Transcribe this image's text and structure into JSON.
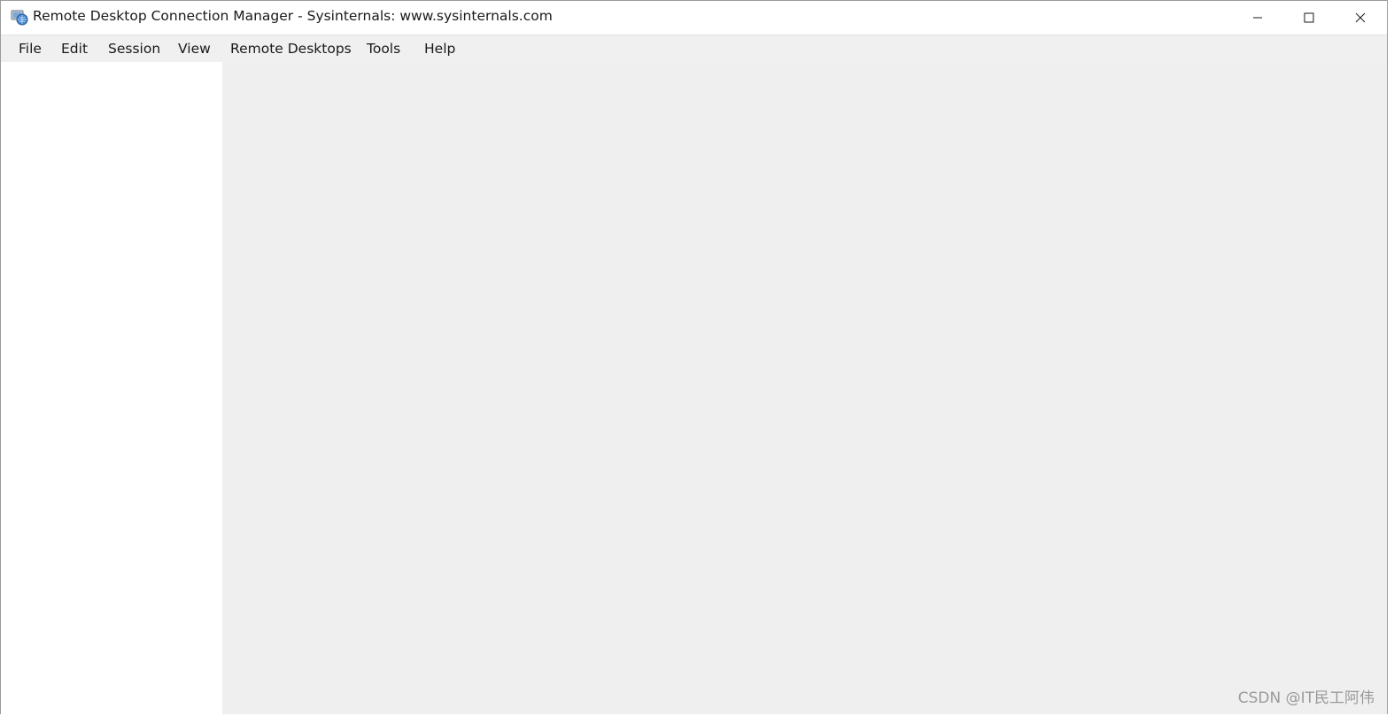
{
  "window": {
    "title": "Remote Desktop Connection Manager - Sysinternals: www.sysinternals.com",
    "icon": "rdcman-app-icon",
    "controls": {
      "minimize_icon": "minimize-icon",
      "maximize_icon": "maximize-icon",
      "close_icon": "close-icon"
    }
  },
  "menubar": {
    "items": [
      {
        "label": "File"
      },
      {
        "label": "Edit"
      },
      {
        "label": "Session"
      },
      {
        "label": "View"
      },
      {
        "label": "Remote Desktops"
      },
      {
        "label": "Tools"
      },
      {
        "label": "Help"
      }
    ]
  },
  "colors": {
    "titlebar_bg": "#ffffff",
    "menubar_bg": "#f0f0f0",
    "tree_panel_bg": "#ffffff",
    "content_bg": "#efefef"
  },
  "watermark": {
    "text": "CSDN @IT民工阿伟"
  }
}
